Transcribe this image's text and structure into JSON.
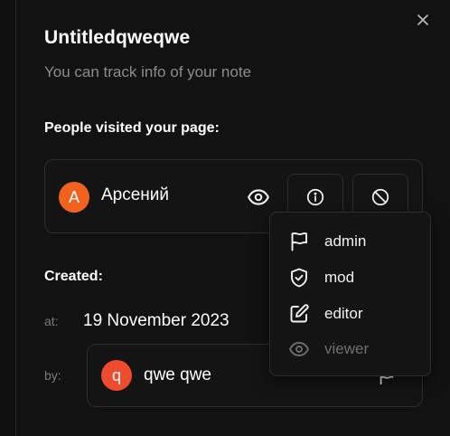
{
  "panel": {
    "title": "Untitledqweqwe",
    "subtitle": "You can track info of your note"
  },
  "visitors": {
    "label": "People visited your page:",
    "items": [
      {
        "initial": "А",
        "name": "Арсений",
        "avatar_color": "#f2621f",
        "actions": [
          "eye-icon",
          "info-icon",
          "block-icon"
        ]
      }
    ]
  },
  "role_menu": {
    "items": [
      {
        "label": "admin",
        "icon": "flag-icon",
        "disabled": false
      },
      {
        "label": "mod",
        "icon": "shield-check-icon",
        "disabled": false
      },
      {
        "label": "editor",
        "icon": "edit-icon",
        "disabled": false
      },
      {
        "label": "viewer",
        "icon": "eye-icon",
        "disabled": true
      }
    ]
  },
  "created": {
    "label": "Created:",
    "at_label": "at:",
    "date": "19 November 2023",
    "by_label": "by:",
    "author": {
      "initial": "q",
      "name": "qwe qwe",
      "avatar_color": "#ef4b2e"
    }
  },
  "colors": {
    "background": "#121212",
    "border": "#2e2e2e",
    "muted_text": "#8c8c8c",
    "avatar_orange": "#f2621f"
  }
}
